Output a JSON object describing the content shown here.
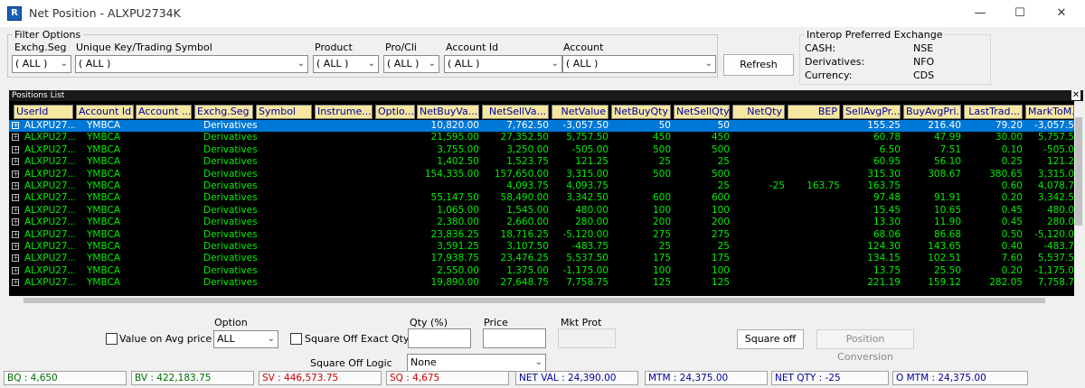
{
  "window": {
    "title": "Net Position - ALXPU2734K",
    "icon": "app-logo-icon"
  },
  "filter": {
    "group_label": "Filter Options",
    "exchg_seg": {
      "label": "Exchg.Seg",
      "value": "( ALL )"
    },
    "unique_key": {
      "label": "Unique Key/Trading Symbol",
      "value": "( ALL )"
    },
    "product": {
      "label": "Product",
      "value": "( ALL )"
    },
    "pro_cli": {
      "label": "Pro/Cli",
      "value": "( ALL )"
    },
    "account_id": {
      "label": "Account Id",
      "value": "( ALL )"
    },
    "account": {
      "label": "Account",
      "value": "( ALL )"
    },
    "refresh_label": "Refresh"
  },
  "interop": {
    "title": "Interop Preferred Exchange",
    "rows": [
      {
        "key": "CASH:",
        "value": "NSE"
      },
      {
        "key": "Derivatives:",
        "value": "NFO"
      },
      {
        "key": "Currency:",
        "value": "CDS"
      }
    ]
  },
  "grid": {
    "caption": "Positions List",
    "columns": [
      "UserId",
      "Account Id",
      "Account ...",
      "Exchg.Seg",
      "Symbol",
      "Instrume...",
      "Optio...",
      "NetBuyVa...",
      "NetSellVa...",
      "NetValue",
      "NetBuyQty",
      "NetSellQty",
      "NetQty",
      "BEP",
      "SellAvgPr...",
      "BuyAvgPri...",
      "LastTrad...",
      "MarkToM..."
    ],
    "rows": [
      [
        "ALXPU27...",
        "YMBCA",
        "",
        "Derivatives",
        "",
        "",
        "",
        "10,820.00",
        "7,762.50",
        "-3,057.50",
        "50",
        "50",
        "",
        "",
        "155.25",
        "216.40",
        "79.20",
        "-3,057.5"
      ],
      [
        "ALXPU27...",
        "YMBCA",
        "",
        "Derivatives",
        "",
        "",
        "",
        "21,595.00",
        "27,352.50",
        "5,757.50",
        "450",
        "450",
        "",
        "",
        "60.78",
        "47.99",
        "30.00",
        "5,757.5"
      ],
      [
        "ALXPU27...",
        "YMBCA",
        "",
        "Derivatives",
        "",
        "",
        "",
        "3,755.00",
        "3,250.00",
        "-505.00",
        "500",
        "500",
        "",
        "",
        "6.50",
        "7.51",
        "0.10",
        "-505.0"
      ],
      [
        "ALXPU27...",
        "YMBCA",
        "",
        "Derivatives",
        "",
        "",
        "",
        "1,402.50",
        "1,523.75",
        "121.25",
        "25",
        "25",
        "",
        "",
        "60.95",
        "56.10",
        "0.25",
        "121.2"
      ],
      [
        "ALXPU27...",
        "YMBCA",
        "",
        "Derivatives",
        "",
        "",
        "",
        "154,335.00",
        "157,650.00",
        "3,315.00",
        "500",
        "500",
        "",
        "",
        "315.30",
        "308.67",
        "380.65",
        "3,315.0"
      ],
      [
        "ALXPU27...",
        "YMBCA",
        "",
        "Derivatives",
        "",
        "",
        "",
        "",
        "4,093.75",
        "4,093.75",
        "",
        "25",
        "-25",
        "163.75",
        "163.75",
        "",
        "0.60",
        "4,078.7"
      ],
      [
        "ALXPU27...",
        "YMBCA",
        "",
        "Derivatives",
        "",
        "",
        "",
        "55,147.50",
        "58,490.00",
        "3,342.50",
        "600",
        "600",
        "",
        "",
        "97.48",
        "91.91",
        "0.20",
        "3,342.5"
      ],
      [
        "ALXPU27...",
        "YMBCA",
        "",
        "Derivatives",
        "",
        "",
        "",
        "1,065.00",
        "1,545.00",
        "480.00",
        "100",
        "100",
        "",
        "",
        "15.45",
        "10.65",
        "0.45",
        "480.0"
      ],
      [
        "ALXPU27...",
        "YMBCA",
        "",
        "Derivatives",
        "",
        "",
        "",
        "2,380.00",
        "2,660.00",
        "280.00",
        "200",
        "200",
        "",
        "",
        "13.30",
        "11.90",
        "0.45",
        "280.0"
      ],
      [
        "ALXPU27...",
        "YMBCA",
        "",
        "Derivatives",
        "",
        "",
        "",
        "23,836.25",
        "18,716.25",
        "-5,120.00",
        "275",
        "275",
        "",
        "",
        "68.06",
        "86.68",
        "0.50",
        "-5,120.0"
      ],
      [
        "ALXPU27...",
        "YMBCA",
        "",
        "Derivatives",
        "",
        "",
        "",
        "3,591.25",
        "3,107.50",
        "-483.75",
        "25",
        "25",
        "",
        "",
        "124.30",
        "143.65",
        "0.40",
        "-483.7"
      ],
      [
        "ALXPU27...",
        "YMBCA",
        "",
        "Derivatives",
        "",
        "",
        "",
        "17,938.75",
        "23,476.25",
        "5,537.50",
        "175",
        "175",
        "",
        "",
        "134.15",
        "102.51",
        "7.60",
        "5,537.5"
      ],
      [
        "ALXPU27...",
        "YMBCA",
        "",
        "Derivatives",
        "",
        "",
        "",
        "2,550.00",
        "1,375.00",
        "-1,175.00",
        "100",
        "100",
        "",
        "",
        "13.75",
        "25.50",
        "0.20",
        "-1,175.0"
      ],
      [
        "ALXPU27...",
        "YMBCA",
        "",
        "Derivatives",
        "",
        "",
        "",
        "19,890.00",
        "27,648.75",
        "7,758.75",
        "125",
        "125",
        "",
        "",
        "221.19",
        "159.12",
        "282.05",
        "7,758.7"
      ]
    ]
  },
  "controls": {
    "option_label": "Option",
    "option_value": "ALL",
    "value_on_avg_label": "Value on Avg  price",
    "square_off_exact_label": "Square Off Exact Qty",
    "qty_label": "Qty (%)",
    "price_label": "Price",
    "mkt_prot_label": "Mkt Prot",
    "square_off_logic_label": "Square Off Logic",
    "square_off_logic_value": "None",
    "square_off_button": "Square off",
    "position_conversion_button": "Position Conversion"
  },
  "status": [
    {
      "text": "BQ : 4,650",
      "color": "#007000"
    },
    {
      "text": "BV : 422,183.75",
      "color": "#007000"
    },
    {
      "text": "SV : 446,573.75",
      "color": "#d00000"
    },
    {
      "text": "SQ : 4,675",
      "color": "#d00000"
    },
    {
      "text": "NET VAL : 24,390.00",
      "color": "#0000a0"
    },
    {
      "text": "MTM : 24,375.00",
      "color": "#0000a0"
    },
    {
      "text": "NET QTY : -25",
      "color": "#0000a0"
    },
    {
      "text": "O MTM : 24,375.00",
      "color": "#0000a0"
    }
  ]
}
